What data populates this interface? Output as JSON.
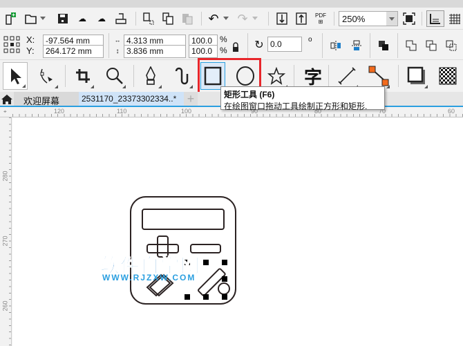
{
  "toolbar": {
    "zoom_value": "250%",
    "pdf_label": "PDF"
  },
  "property_bar": {
    "x_label": "X:",
    "y_label": "Y:",
    "x_value": "-97.564 mm",
    "y_value": "264.172 mm",
    "width_value": "4.313 mm",
    "height_value": "3.836 mm",
    "scale_w": "100.0",
    "scale_h": "100.0",
    "percent": "%",
    "rotation": "0.0",
    "degree": "o"
  },
  "tooltip": {
    "title": "矩形工具 (F6)",
    "description": "在绘图窗口拖动工具绘制正方形和矩形."
  },
  "tabs": [
    {
      "label": "欢迎屏幕"
    },
    {
      "label": "2531170_23373302334..*"
    }
  ],
  "ruler": {
    "h": [
      "120",
      "110",
      "100",
      "90",
      "80",
      "70",
      "60"
    ],
    "v": [
      "280",
      "270",
      "260"
    ]
  },
  "watermark": {
    "title": "软件自学网",
    "url": "WWW.RJZXW.COM"
  },
  "colors": {
    "highlight": "#e8262b",
    "accent": "#1e7ec8"
  }
}
